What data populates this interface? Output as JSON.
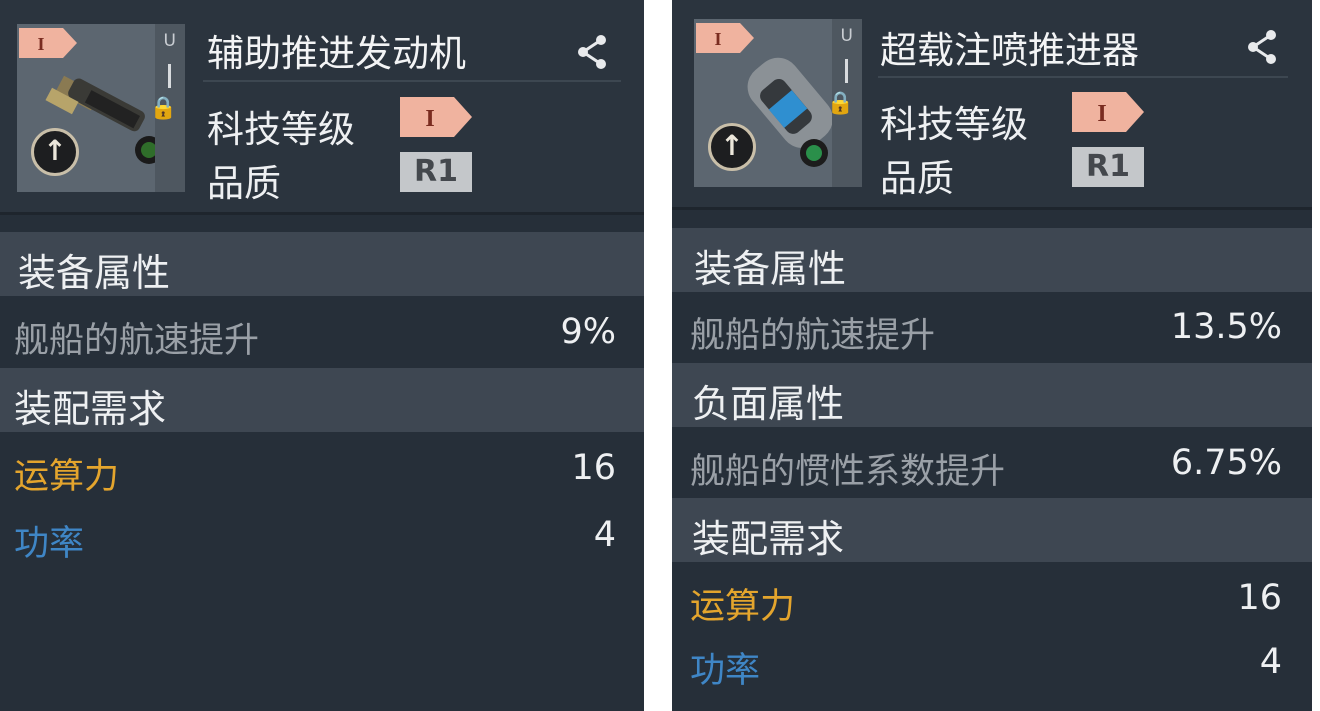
{
  "left": {
    "thumb": {
      "tier": "I",
      "u_label": "U"
    },
    "name": "辅助推进发动机",
    "tech_level_label": "科技等级",
    "tech_tier": "I",
    "quality_label": "品质",
    "quality_value": "R1",
    "sections": {
      "equip_attr": {
        "title": "装备属性",
        "rows": [
          {
            "label": "舰船的航速提升",
            "value": "9%"
          }
        ]
      },
      "requirements": {
        "title": "装配需求",
        "cpu_label": "运算力",
        "cpu_value": "16",
        "power_label": "功率",
        "power_value": "4"
      }
    }
  },
  "right": {
    "thumb": {
      "tier": "I",
      "u_label": "U"
    },
    "name": "超载注喷推进器",
    "tech_level_label": "科技等级",
    "tech_tier": "I",
    "quality_label": "品质",
    "quality_value": "R1",
    "sections": {
      "equip_attr": {
        "title": "装备属性",
        "rows": [
          {
            "label": "舰船的航速提升",
            "value": "13.5%"
          }
        ]
      },
      "negative_attr": {
        "title": "负面属性",
        "rows": [
          {
            "label": "舰船的惯性系数提升",
            "value": "6.75%"
          }
        ]
      },
      "requirements": {
        "title": "装配需求",
        "cpu_label": "运算力",
        "cpu_value": "16",
        "power_label": "功率",
        "power_value": "4"
      }
    }
  },
  "colors": {
    "panel_bg": "#262f39",
    "section_bg": "#3e4752",
    "cpu_label": "#e4a52d",
    "power_label": "#3f86c6",
    "tier_badge": "#f0b39f",
    "quality_badge": "#c4c7ca"
  }
}
